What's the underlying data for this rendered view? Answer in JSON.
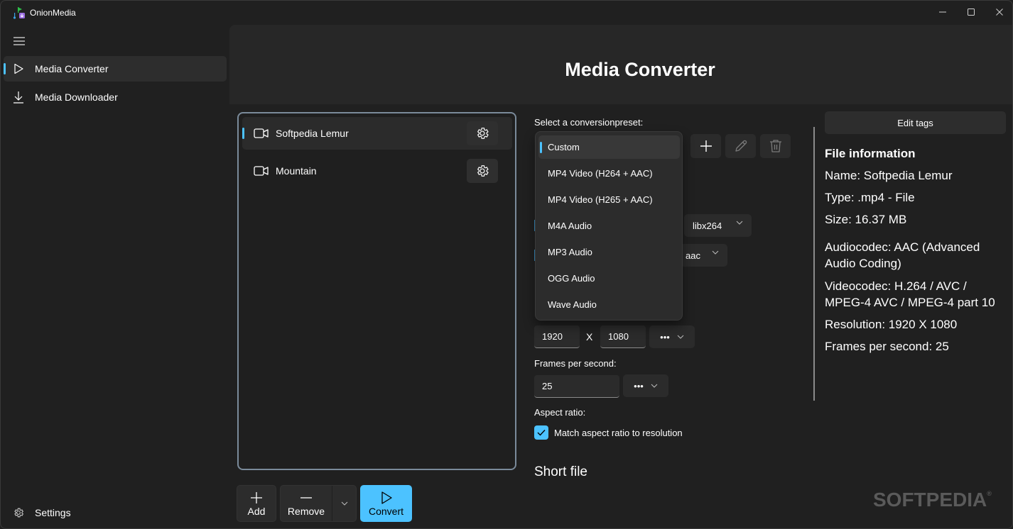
{
  "window": {
    "title": "OnionMedia",
    "controls": {
      "minimize": "minimize",
      "maximize": "maximize",
      "close": "close"
    }
  },
  "sidebar": {
    "items": [
      {
        "label": "Media Converter",
        "icon": "play-icon",
        "selected": true
      },
      {
        "label": "Media Downloader",
        "icon": "download-icon",
        "selected": false
      }
    ],
    "settings_label": "Settings"
  },
  "header": {
    "title": "Media Converter"
  },
  "files": [
    {
      "name": "Softpedia Lemur",
      "selected": true
    },
    {
      "name": "Mountain",
      "selected": false
    }
  ],
  "actions": {
    "add_label": "Add",
    "remove_label": "Remove",
    "convert_label": "Convert"
  },
  "converter": {
    "preset_label": "Select a conversionpreset:",
    "preset_options": [
      "Custom",
      "MP4 Video (H264 + AAC)",
      "MP4 Video (H265 + AAC)",
      "M4A Audio",
      "MP3 Audio",
      "OGG Audio",
      "Wave Audio"
    ],
    "preset_selected": "Custom",
    "video_codec": "libx264",
    "audio_codec": "aac",
    "resolution_width": "1920",
    "resolution_separator": "X",
    "resolution_height": "1080",
    "more_label": "•••",
    "fps_label": "Frames per second:",
    "fps_value": "25",
    "aspect_label": "Aspect ratio:",
    "aspect_checkbox_label": "Match aspect ratio to resolution",
    "aspect_checked": true,
    "short_file_heading": "Short file"
  },
  "file_info": {
    "edit_tags_label": "Edit tags",
    "title": "File information",
    "name": "Name: Softpedia Lemur",
    "type": "Type: .mp4 - File",
    "size": "Size: 16.37 MB",
    "audiocodec": "Audiocodec: AAC (Advanced Audio Coding)",
    "videocodec": "Videocodec: H.264 / AVC / MPEG-4 AVC / MPEG-4 part 10",
    "resolution": "Resolution: 1920 X 1080",
    "fps": "Frames per second: 25"
  },
  "colors": {
    "accent": "#4cc2ff",
    "background": "#202020",
    "surface": "#2b2b2b",
    "header": "#272727"
  },
  "watermark": {
    "text": "SOFTPEDIA",
    "mark": "®"
  }
}
